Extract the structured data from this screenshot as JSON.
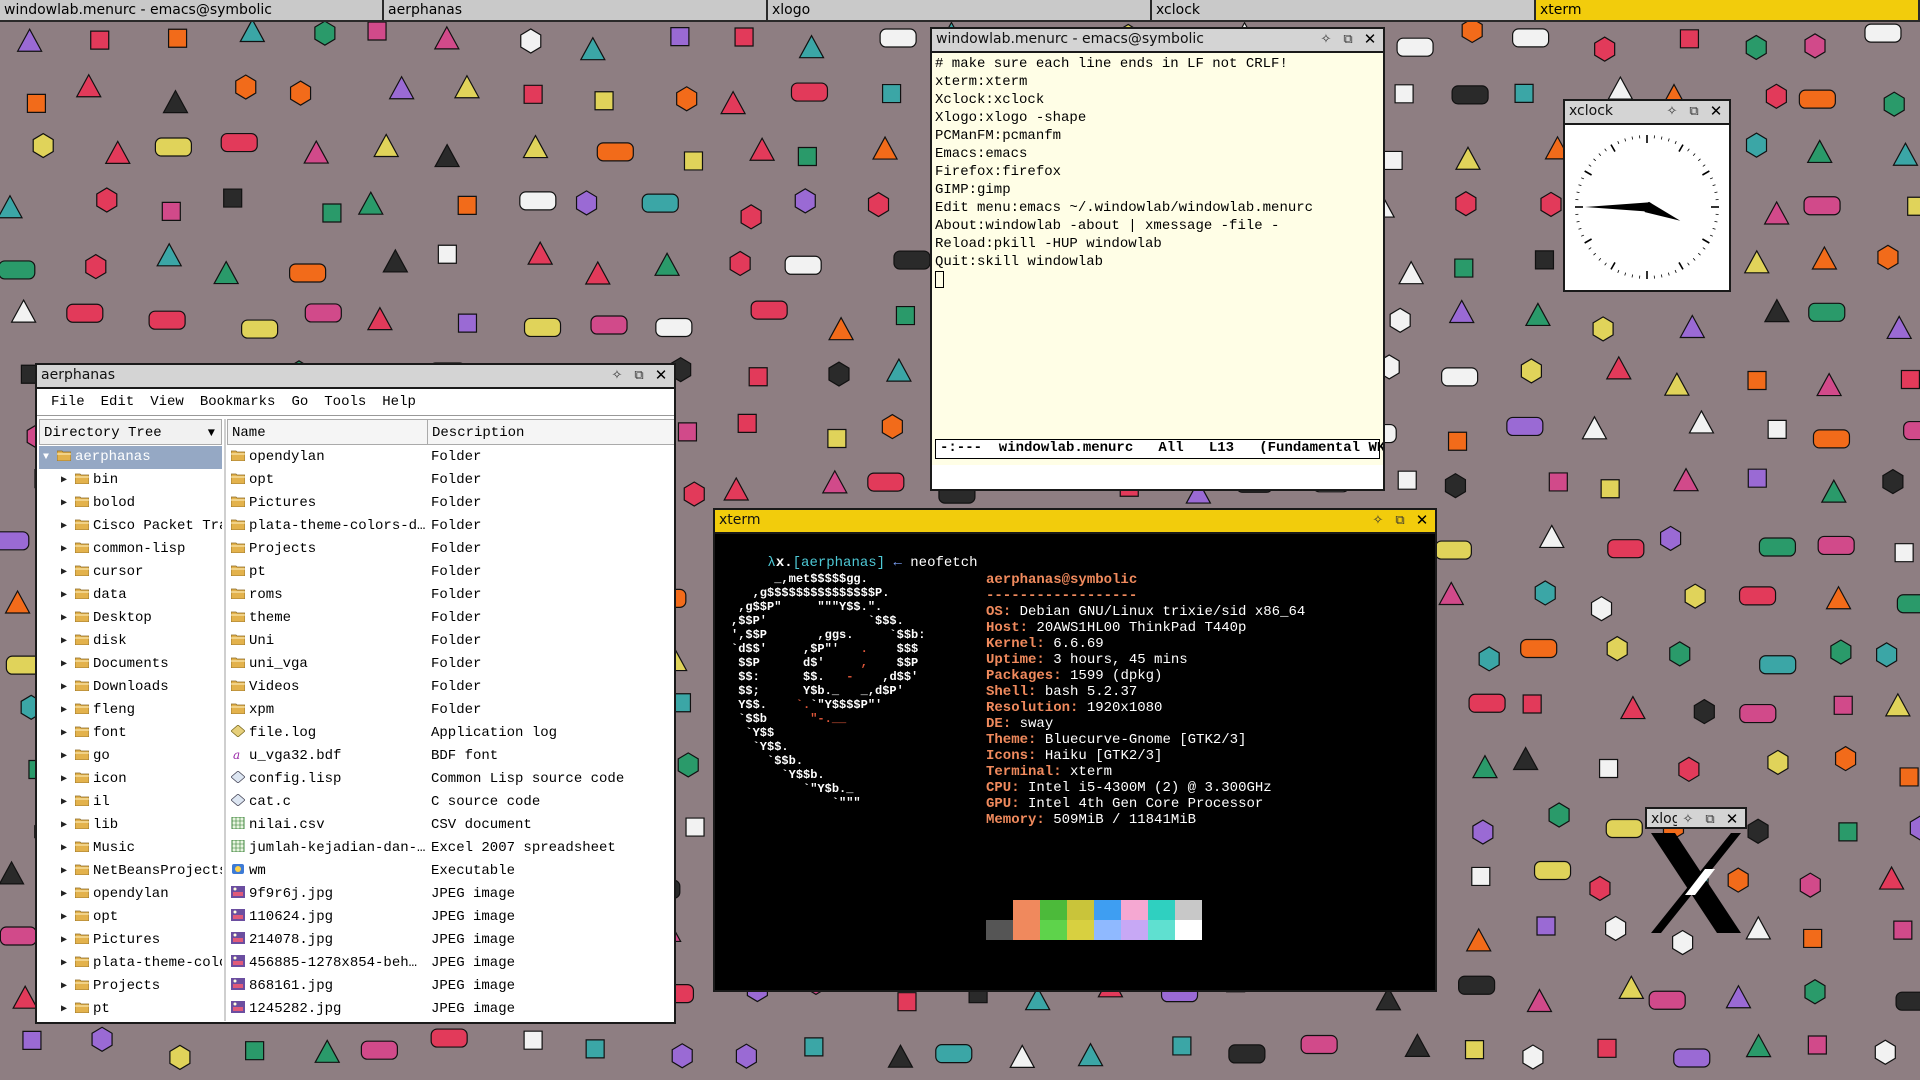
{
  "taskbar": [
    {
      "label": "windowlab.menurc - emacs@symbolic",
      "active": false
    },
    {
      "label": "aerphanas",
      "active": false
    },
    {
      "label": "xlogo",
      "active": false
    },
    {
      "label": "xclock",
      "active": false
    },
    {
      "label": "xterm",
      "active": true
    }
  ],
  "emacs": {
    "title": "windowlab.menurc - emacs@symbolic",
    "lines": [
      "# make sure each line ends in LF not CRLF!",
      "xterm:xterm",
      "Xclock:xclock",
      "Xlogo:xlogo -shape",
      "PCManFM:pcmanfm",
      "Emacs:emacs",
      "Firefox:firefox",
      "GIMP:gimp",
      "Edit menu:emacs ~/.windowlab/windowlab.menurc",
      "About:windowlab -about | xmessage -file -",
      "Reload:pkill -HUP windowlab",
      "Quit:skill windowlab"
    ],
    "modeline": "-:---  windowlab.menurc   All   L13   (Fundamental WK"
  },
  "xclock": {
    "title": "xclock",
    "time": "3:45"
  },
  "xlogo": {
    "title": "xlog"
  },
  "pcmanfm": {
    "title": "aerphanas",
    "menu": [
      "File",
      "Edit",
      "View",
      "Bookmarks",
      "Go",
      "Tools",
      "Help"
    ],
    "sidebar_mode": "Directory Tree",
    "tree_root": "aerphanas",
    "tree": [
      "bin",
      "bolod",
      "Cisco Packet Trac",
      "common-lisp",
      "cursor",
      "data",
      "Desktop",
      "disk",
      "Documents",
      "Downloads",
      "fleng",
      "font",
      "go",
      "icon",
      "il",
      "lib",
      "Music",
      "NetBeansProjects",
      "opendylan",
      "opt",
      "Pictures",
      "plata-theme-color",
      "Projects",
      "pt"
    ],
    "columns": {
      "name": "Name",
      "description": "Description"
    },
    "files": [
      {
        "name": "opendylan",
        "desc": "Folder",
        "icon": "folder"
      },
      {
        "name": "opt",
        "desc": "Folder",
        "icon": "folder"
      },
      {
        "name": "Pictures",
        "desc": "Folder",
        "icon": "folder"
      },
      {
        "name": "plata-theme-colors-d…",
        "desc": "Folder",
        "icon": "folder"
      },
      {
        "name": "Projects",
        "desc": "Folder",
        "icon": "folder"
      },
      {
        "name": "pt",
        "desc": "Folder",
        "icon": "folder"
      },
      {
        "name": "roms",
        "desc": "Folder",
        "icon": "folder"
      },
      {
        "name": "theme",
        "desc": "Folder",
        "icon": "folder"
      },
      {
        "name": "Uni",
        "desc": "Folder",
        "icon": "folder"
      },
      {
        "name": "uni_vga",
        "desc": "Folder",
        "icon": "folder"
      },
      {
        "name": "Videos",
        "desc": "Folder",
        "icon": "folder"
      },
      {
        "name": "xpm",
        "desc": "Folder",
        "icon": "folder"
      },
      {
        "name": "file.log",
        "desc": "Application log",
        "icon": "log"
      },
      {
        "name": "u_vga32.bdf",
        "desc": "BDF font",
        "icon": "font"
      },
      {
        "name": "config.lisp",
        "desc": "Common Lisp source code",
        "icon": "code"
      },
      {
        "name": "cat.c",
        "desc": "C source code",
        "icon": "code"
      },
      {
        "name": "nilai.csv",
        "desc": "CSV document",
        "icon": "sheet"
      },
      {
        "name": "jumlah-kejadian-dan-…",
        "desc": "Excel 2007 spreadsheet",
        "icon": "sheet"
      },
      {
        "name": "wm",
        "desc": "Executable",
        "icon": "exec"
      },
      {
        "name": "9f9r6j.jpg",
        "desc": "JPEG image",
        "icon": "image"
      },
      {
        "name": "110624.jpg",
        "desc": "JPEG image",
        "icon": "image"
      },
      {
        "name": "214078.jpg",
        "desc": "JPEG image",
        "icon": "image"
      },
      {
        "name": "456885-1278x854-beh…",
        "desc": "JPEG image",
        "icon": "image"
      },
      {
        "name": "868161.jpg",
        "desc": "JPEG image",
        "icon": "image"
      },
      {
        "name": "1245282.jpg",
        "desc": "JPEG image",
        "icon": "image"
      }
    ]
  },
  "xterm": {
    "title": "xterm",
    "prompt_lambda": "λ",
    "prompt_x": "x.",
    "prompt_dir": "[aerphanas]",
    "prompt_arrow": "←",
    "command": "neofetch",
    "user_host": "aerphanas@symbolic",
    "separator": "------------------",
    "info": [
      {
        "key": "OS",
        "value": "Debian GNU/Linux trixie/sid x86_64"
      },
      {
        "key": "Host",
        "value": "20AWS1HL00 ThinkPad T440p"
      },
      {
        "key": "Kernel",
        "value": "6.6.69"
      },
      {
        "key": "Uptime",
        "value": "3 hours, 45 mins"
      },
      {
        "key": "Packages",
        "value": "1599 (dpkg)"
      },
      {
        "key": "Shell",
        "value": "bash 5.2.37"
      },
      {
        "key": "Resolution",
        "value": "1920x1080"
      },
      {
        "key": "DE",
        "value": "sway"
      },
      {
        "key": "Theme",
        "value": "Bluecurve-Gnome [GTK2/3]"
      },
      {
        "key": "Icons",
        "value": "Haiku [GTK2/3]"
      },
      {
        "key": "Terminal",
        "value": "xterm"
      },
      {
        "key": "CPU",
        "value": "Intel i5-4300M (2) @ 3.300GHz"
      },
      {
        "key": "GPU",
        "value": "Intel 4th Gen Core Processor"
      },
      {
        "key": "Memory",
        "value": "509MiB / 11841MiB"
      }
    ],
    "palette_top": [
      "#000000",
      "#f0895d",
      "#4cba3a",
      "#c9c43a",
      "#3e9ef2",
      "#f5a8d2",
      "#2fd0c0",
      "#c8c8c8"
    ],
    "palette_bottom": [
      "#555555",
      "#f0895d",
      "#5ed34b",
      "#d8d040",
      "#8fb9ff",
      "#c7a8f5",
      "#5fe0d0",
      "#ffffff"
    ],
    "final_cursor": "_"
  },
  "colors": {
    "accent": "#f2cc0c",
    "desktop": "#8e7e82",
    "emacs_bg": "#fffee6"
  }
}
